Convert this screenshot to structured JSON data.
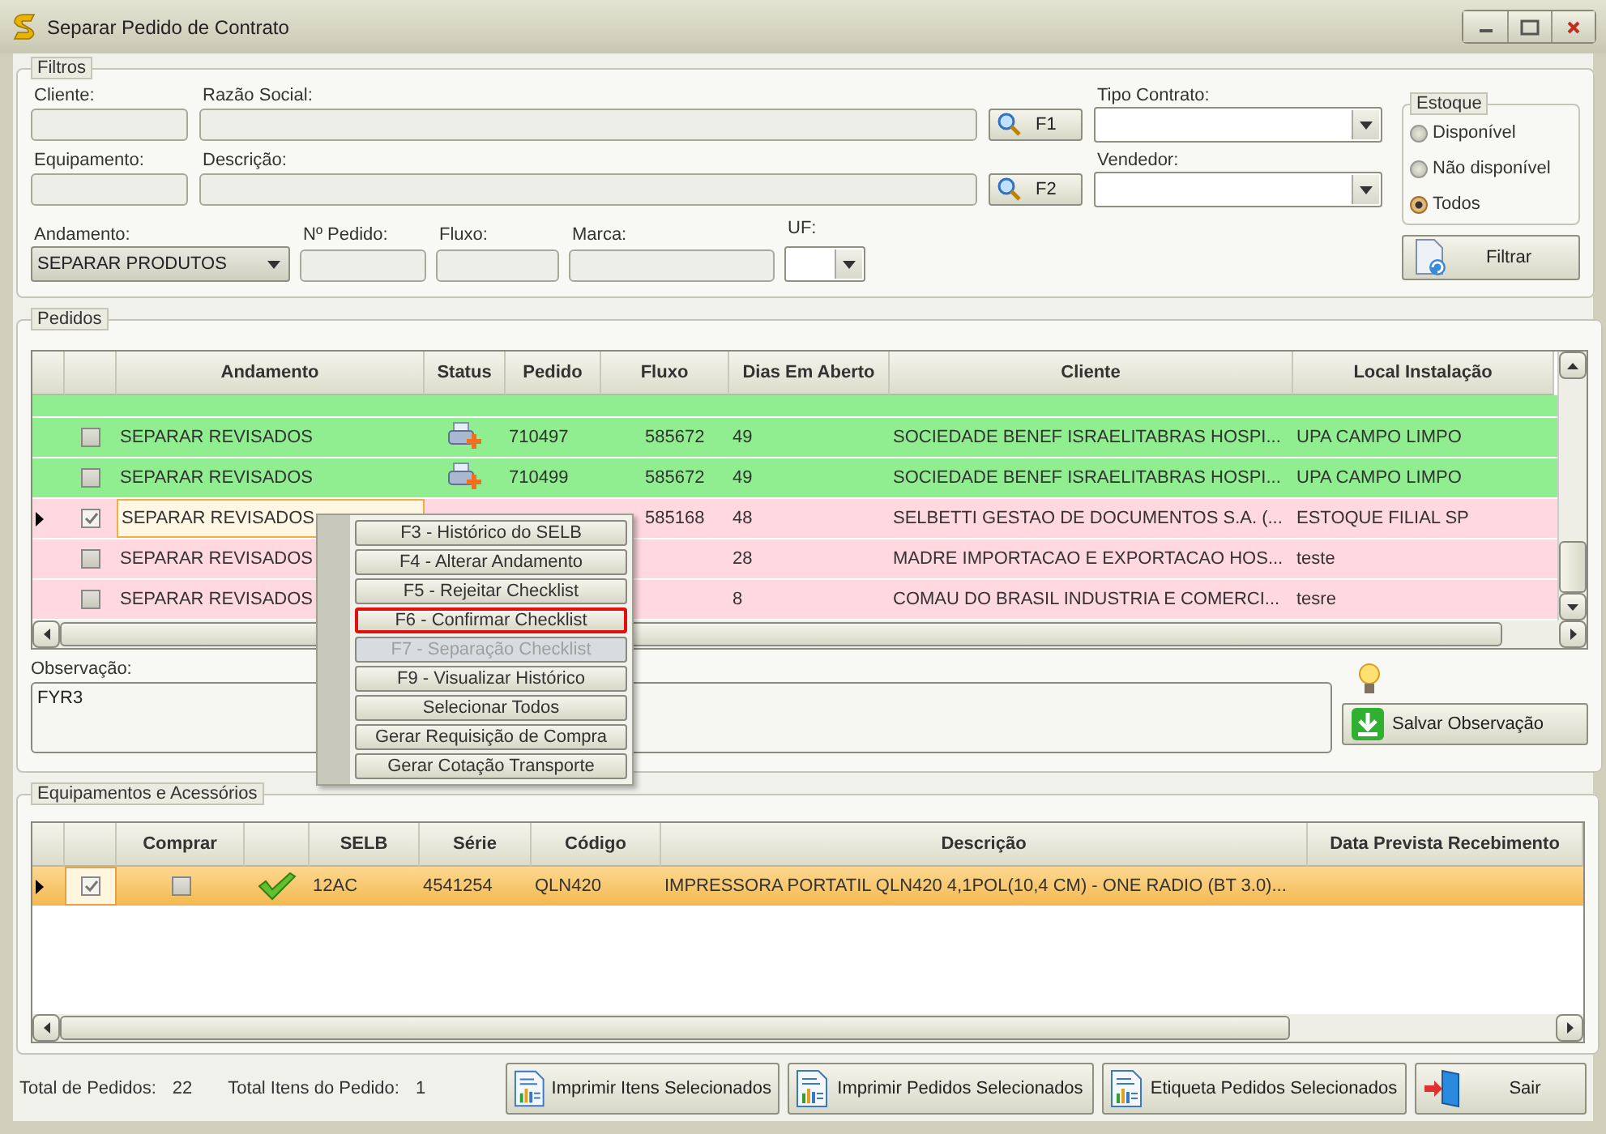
{
  "window": {
    "title": "Separar Pedido de Contrato"
  },
  "filters": {
    "legend": "Filtros",
    "row1": {
      "cliente_label": "Cliente:",
      "razao_label": "Razão Social:",
      "search_button": "F1",
      "tipo_label": "Tipo Contrato:"
    },
    "row2": {
      "equip_label": "Equipamento:",
      "descricao_label": "Descrição:",
      "search_button": "F2",
      "vendedor_label": "Vendedor:"
    },
    "row3": {
      "andamento_label": "Andamento:",
      "andamento_value": "SEPARAR PRODUTOS",
      "pedido_label": "Nº Pedido:",
      "fluxo_label": "Fluxo:",
      "marca_label": "Marca:",
      "uf_label": "UF:"
    },
    "estoque": {
      "legend": "Estoque",
      "options": [
        {
          "label": "Disponível",
          "selected": false
        },
        {
          "label": "Não disponível",
          "selected": false
        },
        {
          "label": "Todos",
          "selected": true
        }
      ]
    },
    "filter_button": "Filtrar"
  },
  "orders": {
    "legend": "Pedidos",
    "columns": [
      "Andamento",
      "Status",
      "Pedido",
      "Fluxo",
      "Dias Em Aberto",
      "Cliente",
      "Local Instalação"
    ],
    "rows": [
      {
        "andamento": "SEPARAR REVISADOS",
        "status_icon": true,
        "pedido": "710497",
        "fluxo": "585672",
        "dias": "49",
        "cliente": "SOCIEDADE BENEF ISRAELITABRAS HOSPI...",
        "local": "UPA CAMPO LIMPO",
        "checked": false,
        "selected": false,
        "color": "#90ee90"
      },
      {
        "andamento": "SEPARAR REVISADOS",
        "status_icon": true,
        "pedido": "710499",
        "fluxo": "585672",
        "dias": "49",
        "cliente": "SOCIEDADE BENEF ISRAELITABRAS HOSPI...",
        "local": "UPA CAMPO LIMPO",
        "checked": false,
        "selected": false,
        "color": "#90ee90"
      },
      {
        "andamento": "SEPARAR REVISADOS",
        "status_icon": false,
        "fluxo": "585168",
        "dias": "48",
        "cliente": "SELBETTI GESTAO DE DOCUMENTOS S.A. (...",
        "local": "ESTOQUE FILIAL SP",
        "checked": true,
        "selected": true,
        "color": "#ffd8e0"
      },
      {
        "andamento": "SEPARAR REVISADOS",
        "status_icon": false,
        "dias": "28",
        "cliente": "MADRE IMPORTACAO E EXPORTACAO HOS...",
        "local": "teste",
        "checked": false,
        "selected": false,
        "color": "#ffd8e0"
      },
      {
        "andamento": "SEPARAR REVISADOS",
        "status_icon": false,
        "dias": "8",
        "cliente": "COMAU DO BRASIL INDUSTRIA E COMERCI...",
        "local": "tesre",
        "checked": false,
        "selected": false,
        "color": "#ffd8e0"
      }
    ],
    "observacao_label": "Observação:",
    "observacao": "FYR3",
    "save_button": "Salvar Observação"
  },
  "context_menu": [
    {
      "label": "F3 - Histórico do SELB",
      "disabled": false,
      "selected": false
    },
    {
      "label": "F4 - Alterar Andamento",
      "disabled": false,
      "selected": false
    },
    {
      "label": "F5 - Rejeitar Checklist",
      "disabled": false,
      "selected": false
    },
    {
      "label": "F6 - Confirmar Checklist",
      "disabled": false,
      "selected": true
    },
    {
      "label": "F7 - Separação Checklist",
      "disabled": true,
      "selected": false
    },
    {
      "label": "F9 - Visualizar Histórico",
      "disabled": false,
      "selected": false
    },
    {
      "label": "Selecionar Todos",
      "disabled": false,
      "selected": false
    },
    {
      "label": "Gerar Requisição de Compra",
      "disabled": false,
      "selected": false
    },
    {
      "label": "Gerar Cotação Transporte",
      "disabled": false,
      "selected": false
    }
  ],
  "equipment": {
    "legend": "Equipamentos e Acessórios",
    "columns": [
      "Comprar",
      "SELB",
      "Série",
      "Código",
      "Descrição",
      "Data Prevista Recebimento"
    ],
    "rows": [
      {
        "checked": true,
        "comprar": false,
        "ok_icon": true,
        "selb": "12AC",
        "serie": "4541254",
        "codigo": "QLN420",
        "descricao": "IMPRESSORA PORTATIL QLN420 4,1POL(10,4 CM) - ONE RADIO (BT 3.0)...",
        "selected": true
      }
    ]
  },
  "footer": {
    "total_pedidos_label": "Total de Pedidos:",
    "total_pedidos": "22",
    "total_itens_label": "Total Itens do Pedido:",
    "total_itens": "1",
    "buttons": [
      {
        "label": "Imprimir Itens Selecionados",
        "kind": "report"
      },
      {
        "label": "Imprimir Pedidos Selecionados",
        "kind": "report"
      },
      {
        "label": "Etiqueta Pedidos Selecionados",
        "kind": "report"
      },
      {
        "label": "Sair",
        "kind": "exit"
      }
    ]
  }
}
